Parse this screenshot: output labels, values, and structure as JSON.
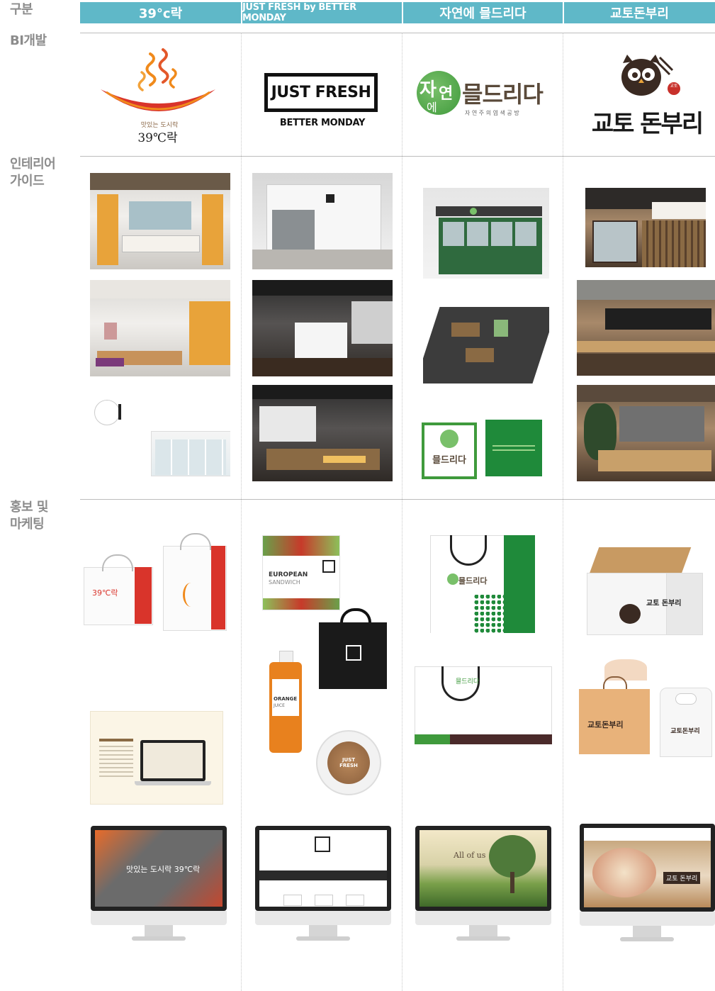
{
  "header": {
    "corner_label": "구분",
    "columns": [
      {
        "label": "39°c락"
      },
      {
        "label": "JUST FRESH by BETTER MONDAY"
      },
      {
        "label": "자연에 믈드리다"
      },
      {
        "label": "교토돈부리"
      }
    ]
  },
  "rows": [
    {
      "label": "BI개발"
    },
    {
      "label": "인테리어\n가이드"
    },
    {
      "label": "홍보 및\n마케팅"
    }
  ],
  "logos": {
    "brand39": {
      "tagline": "맛있는 도시락",
      "name": "39℃락"
    },
    "justfresh": {
      "main": "JUST FRESH",
      "sub": "BETTER MONDAY"
    },
    "nature": {
      "char1": "자",
      "char2": "연",
      "char3": "에",
      "main": "믈드리다",
      "sub": "자 연 주 의 염 색 공 방"
    },
    "kyoto": {
      "main": "교토 돈부리",
      "badge": "교토"
    }
  },
  "marketing": {
    "bag39_text": "39℃락",
    "euro_title": "EUROPEAN",
    "euro_sub": "SANDWICH",
    "juice_label": "ORANGE",
    "juice_sub": "JUICE",
    "bag_nature_text": "믈드리다",
    "box_kyoto_text": "교토 돈부리",
    "tag_kyoto_text": "교토돈부리",
    "web_39_text": "맛있는 도시락 39℃락",
    "web_nature_text": "All of us",
    "web_kyoto_text": "교토 돈부리",
    "jf_mini": "JUST FRESH"
  },
  "colors": {
    "header_bg": "#5fb8c8",
    "label_gray": "#8c8c8c",
    "brand39_red": "#d9342b",
    "brand39_orange": "#f08a1c",
    "nature_green": "#3f9a3c",
    "kyoto_brown": "#3a2a22"
  }
}
